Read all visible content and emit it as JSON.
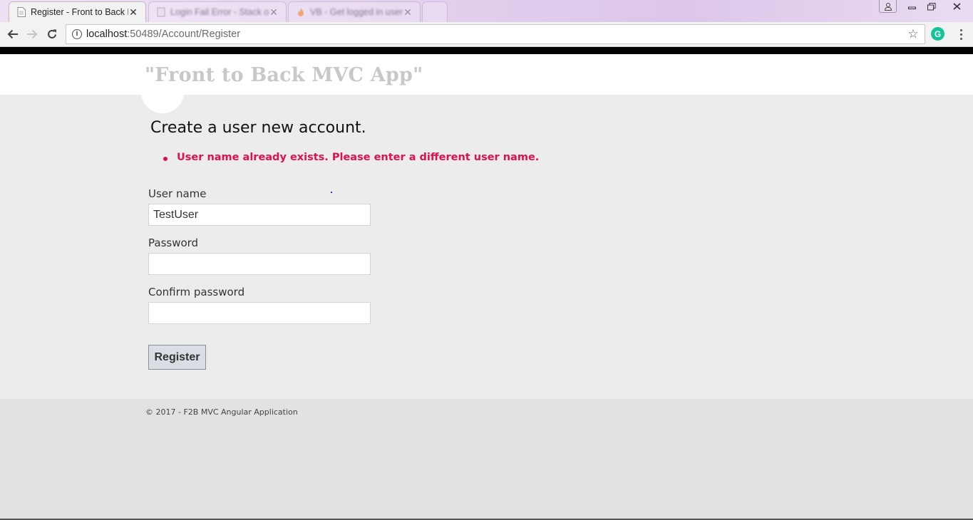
{
  "browser": {
    "tabs": [
      {
        "title": "Register - Front to Back M",
        "favicon": "page-icon",
        "active": true
      },
      {
        "title": "Login Fail Error - Stack overflow",
        "favicon": "blank-page-icon",
        "active": false
      },
      {
        "title": "VB - Get logged in user",
        "favicon": "flame-icon",
        "active": false
      },
      {
        "title": "",
        "favicon": "new-tab-icon",
        "active": false
      }
    ],
    "address": {
      "host": "localhost",
      "rest": ":50489/Account/Register"
    },
    "extension_letter": "G"
  },
  "site": {
    "brand": "\"Front to Back MVC App\""
  },
  "form": {
    "title": "Create a user new account.",
    "errors": [
      "User name already exists. Please enter a different user name."
    ],
    "username_label": "User name",
    "username_value": "TestUser",
    "password_label": "Password",
    "password_value": "",
    "confirm_label": "Confirm password",
    "confirm_value": "",
    "submit_label": "Register"
  },
  "footer": {
    "copyright": "© 2017 - F2B MVC Angular Application"
  },
  "colors": {
    "error": "#e0104d",
    "brand_text": "#c8c8c8",
    "grammarly": "#15c39a"
  }
}
